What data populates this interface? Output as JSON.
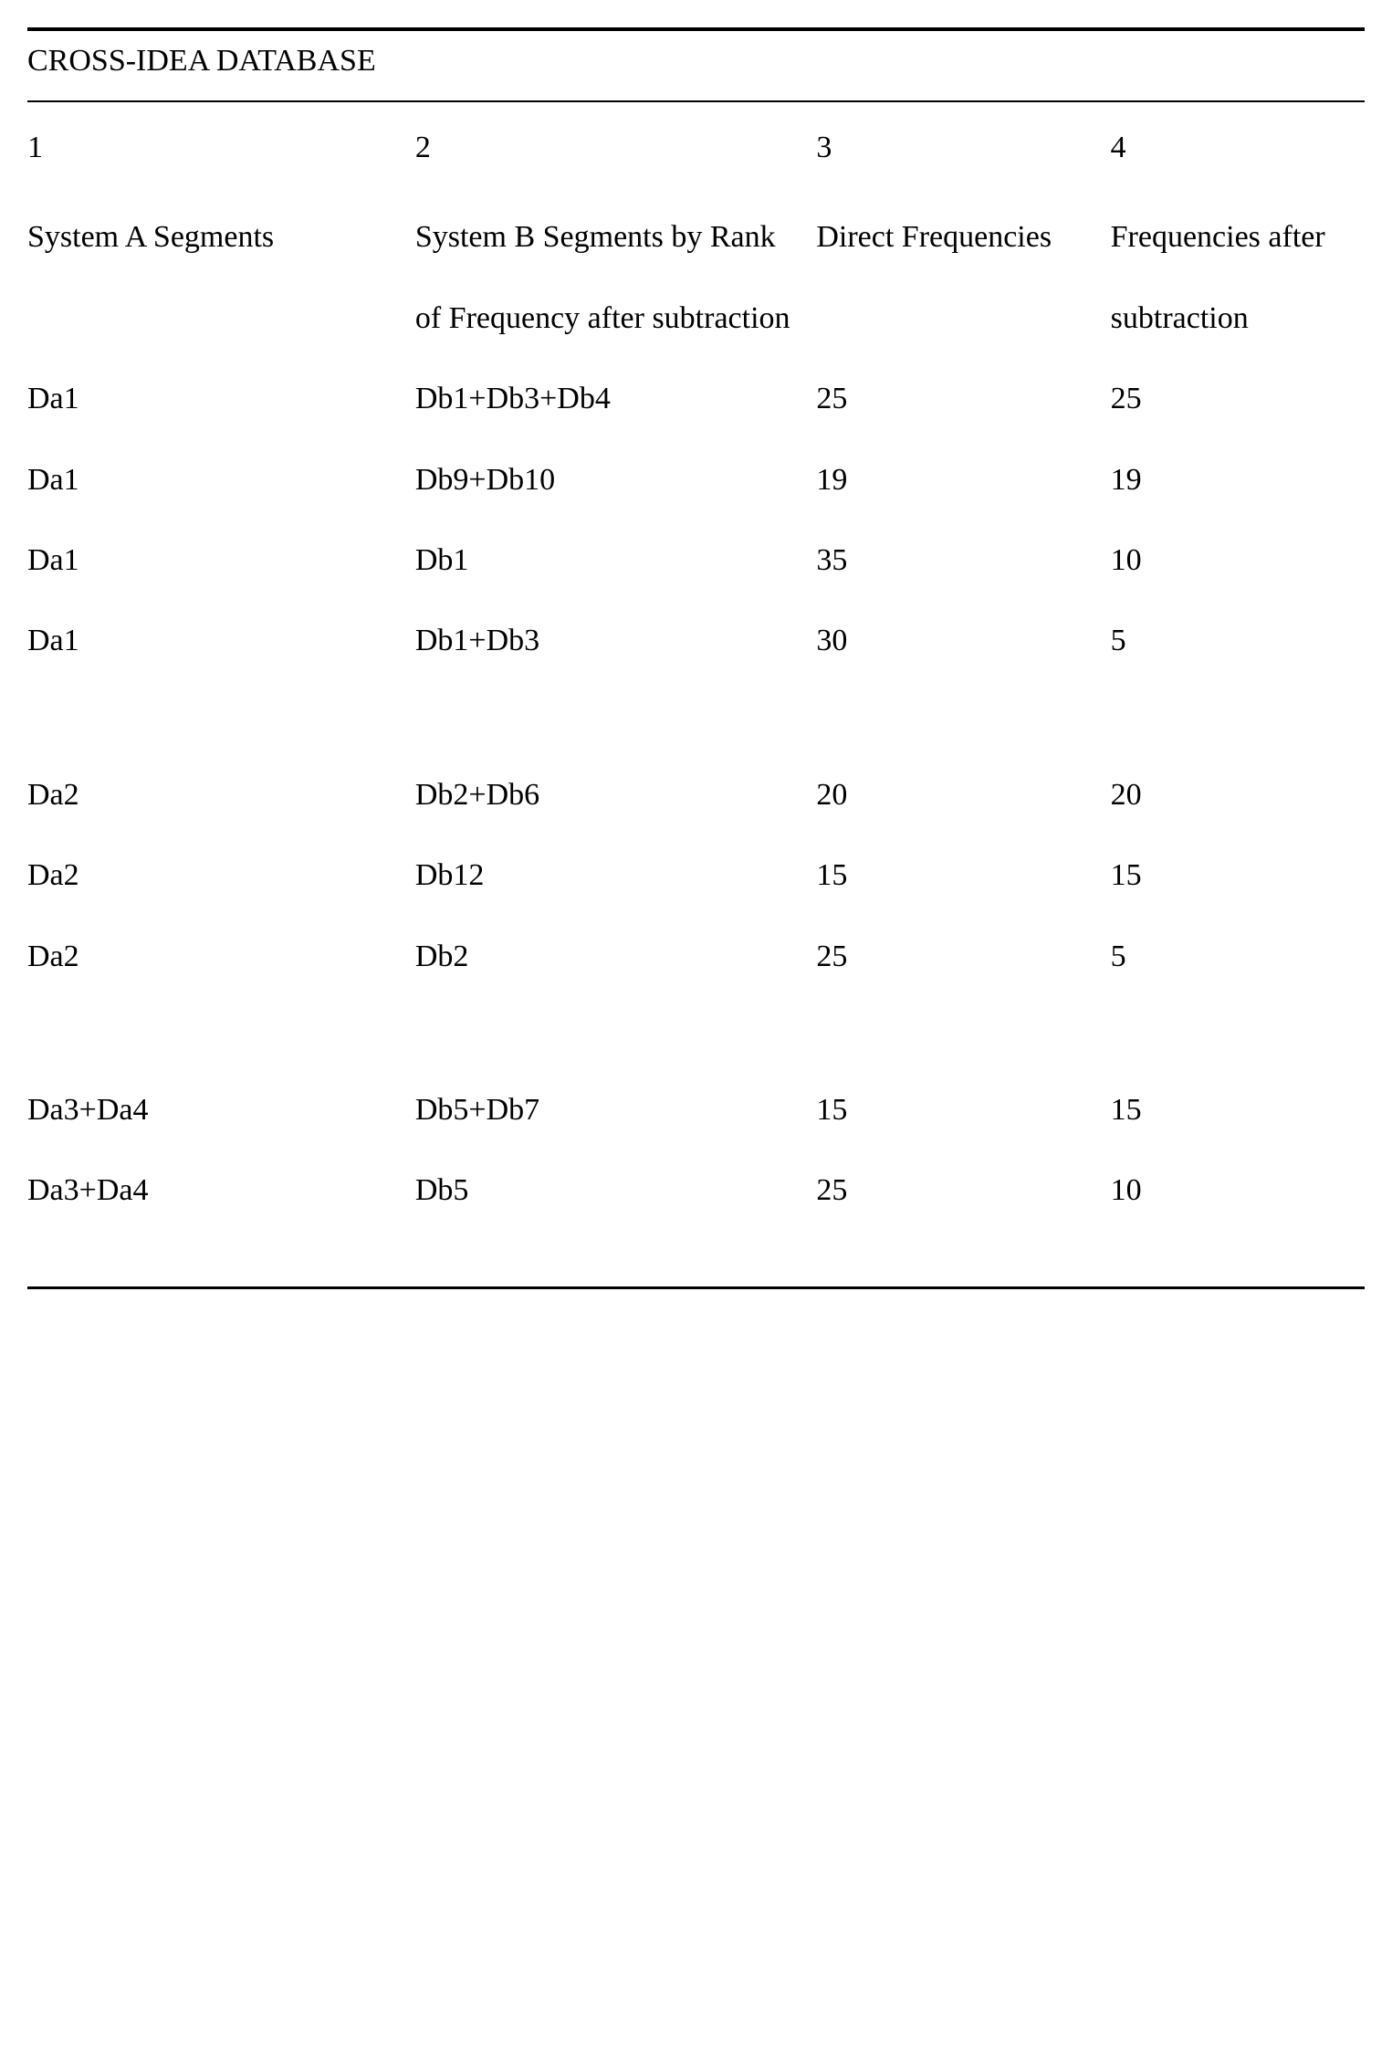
{
  "title": "CROSS-IDEA DATABASE",
  "columns": {
    "nums": [
      "1",
      "2",
      "3",
      "4"
    ],
    "headers": [
      "System A Segments",
      "System B Segments by Rank of Frequency after subtraction",
      "Direct Frequencies",
      "Frequencies after subtraction"
    ]
  },
  "groups": [
    {
      "rows": [
        {
          "c1": "Da1",
          "c2": "Db1+Db3+Db4",
          "c3": "25",
          "c4": "25"
        },
        {
          "c1": "Da1",
          "c2": "Db9+Db10",
          "c3": "19",
          "c4": "19"
        },
        {
          "c1": "Da1",
          "c2": "Db1",
          "c3": "35",
          "c4": "10"
        },
        {
          "c1": "Da1",
          "c2": "Db1+Db3",
          "c3": "30",
          "c4": "5"
        }
      ]
    },
    {
      "rows": [
        {
          "c1": "Da2",
          "c2": "Db2+Db6",
          "c3": "20",
          "c4": "20"
        },
        {
          "c1": "Da2",
          "c2": "Db12",
          "c3": "15",
          "c4": "15"
        },
        {
          "c1": "Da2",
          "c2": "Db2",
          "c3": "25",
          "c4": "5"
        }
      ]
    },
    {
      "rows": [
        {
          "c1": "Da3+Da4",
          "c2": "Db5+Db7",
          "c3": "15",
          "c4": "15"
        },
        {
          "c1": "Da3+Da4",
          "c2": "Db5",
          "c3": "25",
          "c4": "10"
        }
      ]
    }
  ]
}
